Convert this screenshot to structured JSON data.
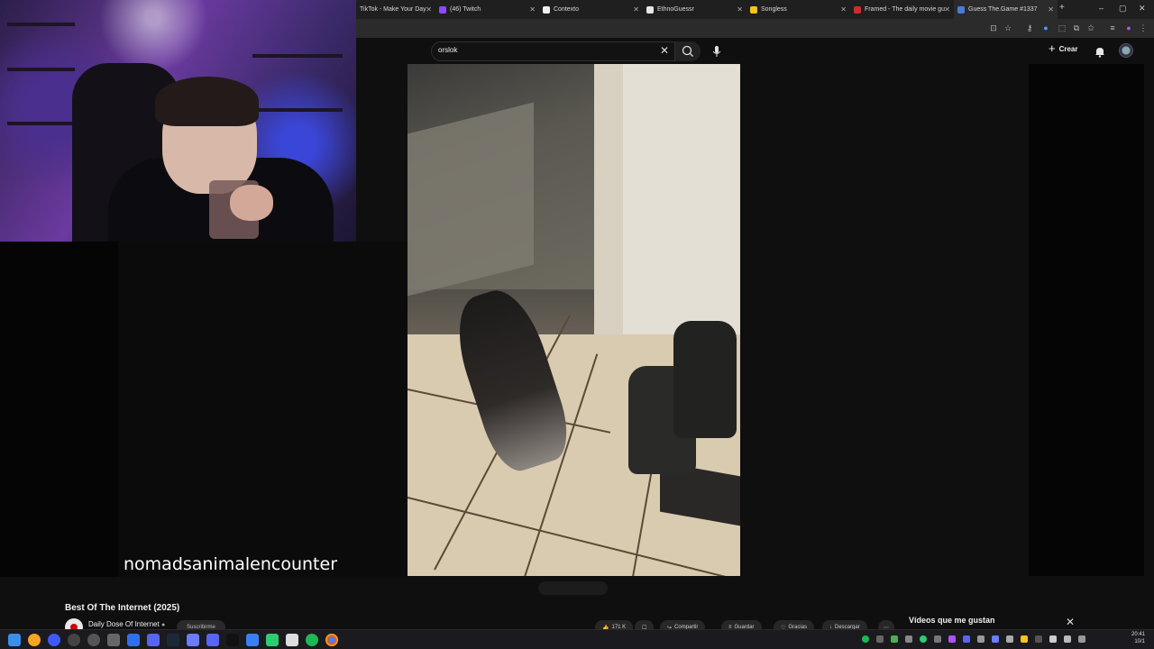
{
  "browser": {
    "tabs": [
      {
        "title": "TikTok - Make Your Day",
        "color": "#111111"
      },
      {
        "title": "(46) Twitch",
        "color": "#9146ff"
      },
      {
        "title": "Contexto",
        "color": "#f0f0f0"
      },
      {
        "title": "EthnoGuessr",
        "color": "#e6e6e6"
      },
      {
        "title": "Songless",
        "color": "#f5c518"
      },
      {
        "title": "Framed - The daily movie gu",
        "color": "#d12c2c"
      },
      {
        "title": "Guess The.Game #1337",
        "color": "#4a7bd6"
      }
    ],
    "window_controls": {
      "minimize": "–",
      "maximize": "▢",
      "close": "✕"
    },
    "new_tab": "+"
  },
  "youtube": {
    "search": {
      "query": "orslok"
    },
    "header": {
      "create_label": "Crear"
    },
    "caption": "nomadsanimalencounter",
    "video_title": "Best Of The Internet (2025)",
    "channel_name": "Daily Dose Of Internet",
    "subscribe_label": "Suscribirme",
    "actions": [
      "171 K",
      "",
      "Compartir",
      "Guardar",
      "Gracias",
      "Descargar"
    ],
    "playlist_panel_title": "Vídeos que me gustan"
  },
  "taskbar": {
    "time": "20:41",
    "date": "10/1"
  },
  "colors": {
    "youtube_bg": "#0f0f0f",
    "tab_bar_bg": "#1f1f1f",
    "toolbar_bg": "#2b2b2b",
    "taskbar_bg": "#1b1b1f"
  }
}
